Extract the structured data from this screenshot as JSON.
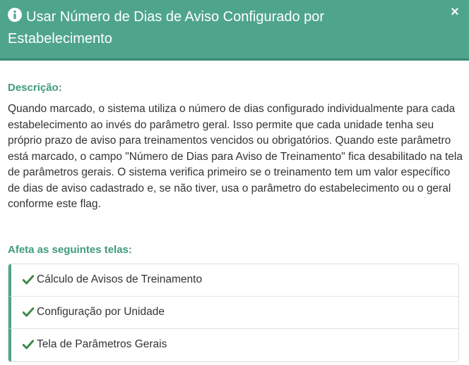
{
  "dialog": {
    "title": "Usar Número de Dias de Aviso Configurado por Estabelecimento",
    "close_label": "×",
    "header_color": "#4fa58c",
    "accent_color": "#3f9a7e"
  },
  "description": {
    "heading": "Descrição:",
    "text": "Quando marcado, o sistema utiliza o número de dias configurado individualmente para cada estabelecimento ao invés do parâmetro geral. Isso permite que cada unidade tenha seu próprio prazo de aviso para treinamentos vencidos ou obrigatórios. Quando este parâmetro está marcado, o campo \"Número de Dias para Aviso de Treinamento\" fica desabilitado na tela de parâmetros gerais. O sistema verifica primeiro se o treinamento tem um valor específico de dias de aviso cadastrado e, se não tiver, usa o parâmetro do estabelecimento ou o geral conforme este flag."
  },
  "affected_screens": {
    "heading": "Afeta as seguintes telas:",
    "items": [
      {
        "label": "Cálculo de Avisos de Treinamento",
        "icon": "check-icon"
      },
      {
        "label": "Configuração por Unidade",
        "icon": "check-icon"
      },
      {
        "label": "Tela de Parâmetros Gerais",
        "icon": "check-icon"
      }
    ]
  }
}
